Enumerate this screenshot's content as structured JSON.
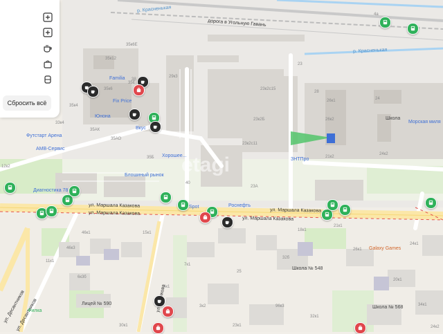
{
  "panel": {
    "reset_label": "Сбросить всё",
    "buttons": [
      "plus-icon",
      "plus-icon",
      "cafe-icon",
      "shop-icon",
      "transport-icon"
    ]
  },
  "streets": {
    "krasnenkaya_top": "р. Красненькая",
    "kraseneaya_right": "р. Красненькая",
    "ugolnaya": "дорога в Угольную Гавань",
    "marshala1": "ул. Маршала Казакова",
    "marshala2": "ул. Маршала Казакова",
    "marshala3": "ул. Маршала Казакова",
    "marshala4": "ул. Маршала Казакова",
    "desantnikov": "ул. Десантников",
    "desantnikov2": "ул. Десантников",
    "kosyakova": "ул. Косякова"
  },
  "pois": {
    "familia": "Familia",
    "fixprice": "Fix Price",
    "yunona": "Юнона",
    "vkus": "Вкус",
    "futstart": "Футстарт Арена",
    "amv": "АМВ-Сервис",
    "horoshee": "Хорошее...",
    "blosh": "Блошиный рынок",
    "diag": "Диагностика 78",
    "sport": "Spot",
    "rosneft": "Роснефть",
    "ztn": "ЗНТПро",
    "shkola": "Школа",
    "morskaya": "Морская миля",
    "galaxy": "Galaxy Games",
    "school548": "Школа № 548",
    "licey590": "Лицей № 590",
    "shkola568": "Школа № 568",
    "filka": "Филка"
  },
  "buildings": {
    "b1": "35к6Е",
    "b2": "35к12",
    "b3": "35к6",
    "b4": "35к4",
    "b5": "35Е",
    "b6": "35АК",
    "b7": "35АО",
    "b8": "33к4",
    "b9": "29к3",
    "b10": "35Б",
    "b11": "23к2с15",
    "b12": "23к2Б",
    "b13": "23к2с11",
    "b14": "23А",
    "b15": "26к1",
    "b16": "26к2",
    "b17": "24",
    "b18": "21к2",
    "b19": "24к2",
    "b20": "46к1",
    "b21": "46к3",
    "b22": "15к1",
    "b23": "11к1",
    "b24": "6к3б",
    "b25": "7к1",
    "b26": "3к2",
    "b27": "32б",
    "b28": "18к1",
    "b29": "26к1",
    "b30": "24к1",
    "b31": "20к1",
    "b32": "34к1",
    "b33": "96к3",
    "b34": "12к2",
    "b35": "30к1",
    "b36": "4к1",
    "b37": "23к1",
    "b38": "24к2",
    "b39": "40",
    "b40": "25",
    "b41": "4a",
    "b42": "28",
    "b43": "23",
    "b44": "38",
    "b45": "21к1",
    "b46": "32к1"
  },
  "watermark": "etagi"
}
